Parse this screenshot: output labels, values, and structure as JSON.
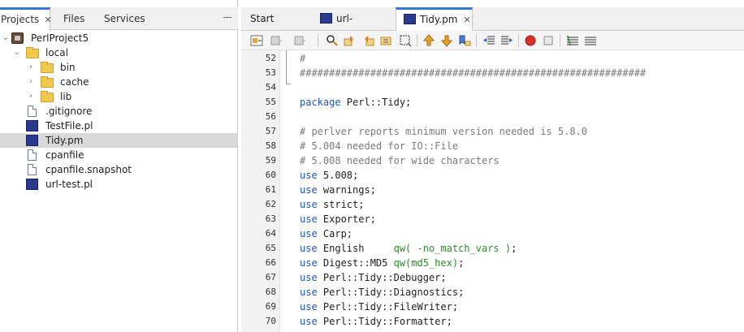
{
  "left_panel": {
    "tabs": [
      {
        "label": "Projects",
        "close": "✕"
      },
      {
        "label": "Files"
      },
      {
        "label": "Services"
      }
    ],
    "minimize": "—",
    "tree": [
      {
        "label": "PerlProject5",
        "icon": "project-icon",
        "arrow": "⌄"
      },
      {
        "label": "local",
        "icon": "folder-icon",
        "arrow": "⌄"
      },
      {
        "label": "bin",
        "icon": "folder-icon",
        "arrow": "›"
      },
      {
        "label": "cache",
        "icon": "folder-icon",
        "arrow": "›"
      },
      {
        "label": "lib",
        "icon": "folder-icon",
        "arrow": "›"
      },
      {
        "label": ".gitignore",
        "icon": "file-icon"
      },
      {
        "label": "TestFile.pl",
        "icon": "perl-file-icon"
      },
      {
        "label": "Tidy.pm",
        "icon": "perl-file-icon",
        "selected": true
      },
      {
        "label": "cpanfile",
        "icon": "file-icon"
      },
      {
        "label": "cpanfile.snapshot",
        "icon": "file-icon"
      },
      {
        "label": "url-test.pl",
        "icon": "perl-file-icon"
      }
    ]
  },
  "editor": {
    "tabs": [
      {
        "label": "Start Page",
        "close": "✕"
      },
      {
        "label": "url-test.pl",
        "close": "✕"
      },
      {
        "label": "Tidy.pm",
        "close": "✕",
        "active": true
      }
    ],
    "toolbar_icons": [
      "history-icon",
      "back-icon",
      "forward-icon",
      "find-icon",
      "find-prev-icon",
      "find-next-icon",
      "toggle-highlight-icon",
      "toggle-rect-select-icon",
      "prev-bookmark-icon",
      "next-bookmark-icon",
      "toggle-bookmark-icon",
      "shift-left-icon",
      "shift-right-icon",
      "start-macro-icon",
      "stop-macro-icon",
      "comment-icon",
      "uncomment-icon"
    ],
    "line_numbers": [
      "52",
      "53",
      "54",
      "55",
      "56",
      "57",
      "58",
      "59",
      "60",
      "61",
      "62",
      "63",
      "64",
      "65",
      "66",
      "67",
      "68",
      "69",
      "70"
    ],
    "code_lines": [
      [
        {
          "t": "#",
          "c": "cm"
        }
      ],
      [
        {
          "t": "###########################################################",
          "c": "cm"
        }
      ],
      [],
      [
        {
          "t": "package",
          "c": "kw"
        },
        {
          "t": " Perl::Tidy;",
          "c": ""
        }
      ],
      [],
      [
        {
          "t": "# perlver reports minimum version needed is 5.8.0",
          "c": "cm"
        }
      ],
      [
        {
          "t": "# 5.004 needed for IO::File",
          "c": "cm"
        }
      ],
      [
        {
          "t": "# 5.008 needed for wide characters",
          "c": "cm"
        }
      ],
      [
        {
          "t": "use",
          "c": "kw"
        },
        {
          "t": " 5.008;",
          "c": ""
        }
      ],
      [
        {
          "t": "use",
          "c": "kw"
        },
        {
          "t": " warnings;",
          "c": ""
        }
      ],
      [
        {
          "t": "use",
          "c": "kw"
        },
        {
          "t": " strict;",
          "c": ""
        }
      ],
      [
        {
          "t": "use",
          "c": "kw"
        },
        {
          "t": " Exporter;",
          "c": ""
        }
      ],
      [
        {
          "t": "use",
          "c": "kw"
        },
        {
          "t": " Carp;",
          "c": ""
        }
      ],
      [
        {
          "t": "use",
          "c": "kw"
        },
        {
          "t": " English     ",
          "c": ""
        },
        {
          "t": "qw( -no_match_vars )",
          "c": "qw"
        },
        {
          "t": ";",
          "c": ""
        }
      ],
      [
        {
          "t": "use",
          "c": "kw"
        },
        {
          "t": " Digest::MD5 ",
          "c": ""
        },
        {
          "t": "qw(md5_hex)",
          "c": "qw"
        },
        {
          "t": ";",
          "c": ""
        }
      ],
      [
        {
          "t": "use",
          "c": "kw"
        },
        {
          "t": " Perl::Tidy::Debugger;",
          "c": ""
        }
      ],
      [
        {
          "t": "use",
          "c": "kw"
        },
        {
          "t": " Perl::Tidy::Diagnostics;",
          "c": ""
        }
      ],
      [
        {
          "t": "use",
          "c": "kw"
        },
        {
          "t": " Perl::Tidy::FileWriter;",
          "c": ""
        }
      ],
      [
        {
          "t": "use",
          "c": "kw"
        },
        {
          "t": " Perl::Tidy::Formatter;",
          "c": ""
        }
      ]
    ]
  },
  "colors": {
    "accent": "#3875d7",
    "keyword": "#1d55bd",
    "comment": "#7a7a7a",
    "qw": "#2e8b2e",
    "selection": "#d9d9d9"
  }
}
